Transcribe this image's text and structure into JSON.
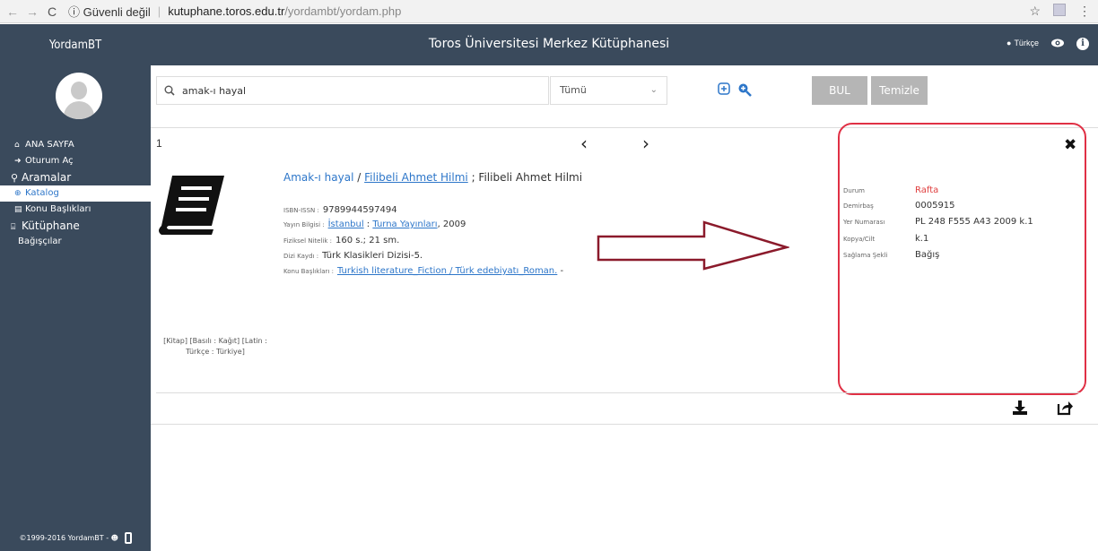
{
  "browser": {
    "security": "Güvenli değil",
    "url_host": "kutuphane.toros.edu.tr",
    "url_path": "/yordambt/yordam.php"
  },
  "header": {
    "brand": "YordamBT",
    "title": "Toros Üniversitesi Merkez Kütüphanesi",
    "language": "Türkçe"
  },
  "sidebar": {
    "items": [
      {
        "label": "ANA SAYFA"
      },
      {
        "label": "Oturum Aç"
      },
      {
        "label": "Aramalar"
      },
      {
        "label": "Katalog"
      },
      {
        "label": "Konu Başlıkları"
      },
      {
        "label": "Kütüphane"
      },
      {
        "label": "Bağışçılar"
      }
    ],
    "footer": "©1999-2016 YordamBT -"
  },
  "search": {
    "query": "amak-ı hayal",
    "scope": "Tümü",
    "find_label": "BUL",
    "clear_label": "Temizle"
  },
  "results": {
    "page": "1",
    "record": {
      "title": "Amak-ı hayal",
      "title_sep": " / ",
      "author_link": "Filibeli Ahmet Hilmi",
      "author_rest": " ; Filibeli Ahmet Hilmi",
      "isbn_label": "ISBN-ISSN :",
      "isbn": "9789944597494",
      "pub_label": "Yayın Bilgisi :",
      "pub_place": "İstanbul",
      "pub_sep": " : ",
      "publisher": "Turna Yayınları",
      "pub_year": ", 2009",
      "phys_label": "Fiziksel Nitelik :",
      "phys": "160 s.; 21 sm.",
      "series_label": "Dizi Kaydı :",
      "series": "Türk Klasikleri Dizisi-5.",
      "subject_label": "Konu Başlıkları :",
      "subject": "Turkish literature_Fiction / Türk edebiyatı_Roman.",
      "subject_tail": " -",
      "format_line1": "[Kitap] [Basılı : Kağıt] [Latin :",
      "format_line2": "Türkçe : Türkiye]"
    }
  },
  "holdings": {
    "rows": [
      {
        "key": "Durum",
        "value": "Rafta"
      },
      {
        "key": "Demirbaş",
        "value": "0005915"
      },
      {
        "key": "Yer Numarası",
        "value": "PL 248 F555 A43 2009 k.1"
      },
      {
        "key": "Kopya/Cilt",
        "value": "k.1"
      },
      {
        "key": "Sağlama Şekli",
        "value": "Bağış"
      }
    ]
  },
  "colors": {
    "sidebar": "#3a4a5c",
    "link": "#2d76c9",
    "highlight": "#e03045",
    "status": "#e04040",
    "arrow": "#8b1a2b"
  },
  "icons": [
    "back-arrow-icon",
    "forward-arrow-icon",
    "reload-icon",
    "info-icon",
    "star-icon",
    "menu-dots-icon",
    "globe-icon",
    "eye-icon",
    "home-icon",
    "sign-in-icon",
    "search-icon",
    "zoom-in-icon",
    "list-icon",
    "bank-icon",
    "plus-square-icon",
    "download-icon",
    "share-icon",
    "close-icon",
    "book-icon"
  ]
}
